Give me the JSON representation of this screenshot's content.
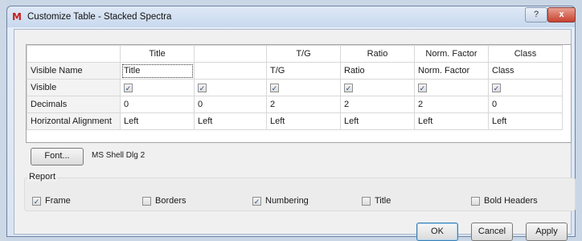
{
  "window": {
    "title": "Customize Table - Stacked Spectra",
    "app_icon_glyph": "M",
    "help_glyph": "?",
    "close_glyph": "x"
  },
  "table": {
    "columns": [
      "Title",
      "",
      "T/G",
      "Ratio",
      "Norm. Factor",
      "Class"
    ],
    "rows": [
      {
        "label": "Visible Name",
        "cells": [
          "Title",
          "",
          "T/G",
          "Ratio",
          "Norm. Factor",
          "Class"
        ]
      },
      {
        "label": "Visible",
        "checks": [
          true,
          true,
          true,
          true,
          true,
          true
        ]
      },
      {
        "label": "Decimals",
        "cells": [
          "0",
          "0",
          "2",
          "2",
          "2",
          "0"
        ]
      },
      {
        "label": "Horizontal Alignment",
        "cells": [
          "Left",
          "Left",
          "Left",
          "Left",
          "Left",
          "Left"
        ]
      }
    ]
  },
  "font": {
    "button_label": "Font...",
    "current": "MS Shell Dlg 2"
  },
  "report": {
    "legend": "Report",
    "options": [
      {
        "label": "Frame",
        "checked": true
      },
      {
        "label": "Borders",
        "checked": false
      },
      {
        "label": "Numbering",
        "checked": true
      },
      {
        "label": "Title",
        "checked": false
      },
      {
        "label": "Bold Headers",
        "checked": false
      }
    ]
  },
  "buttons": {
    "ok": "OK",
    "cancel": "Cancel",
    "apply": "Apply"
  },
  "colors": {
    "check": "#2b4a86",
    "close": "#c7412f"
  }
}
